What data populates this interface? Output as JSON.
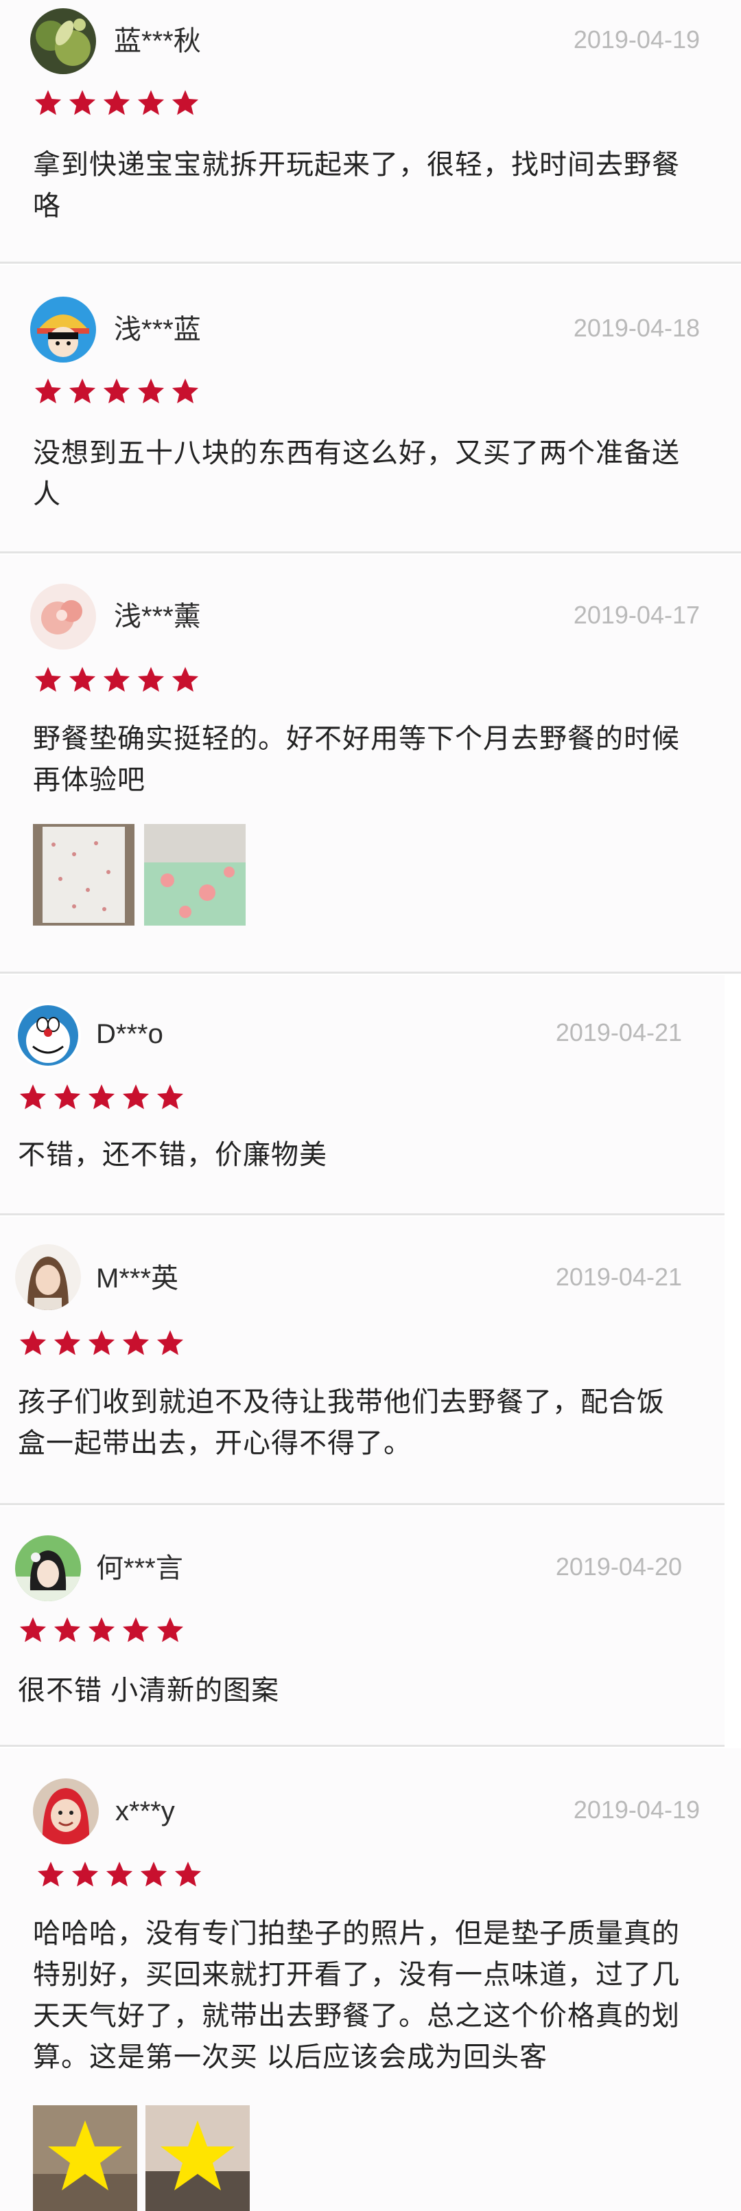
{
  "colors": {
    "star": "#c8102e",
    "date": "#b9b9b9",
    "divider": "#e3e3e3"
  },
  "reviews": [
    {
      "user": "蓝***秋",
      "date": "2019-04-19",
      "rating": 5,
      "avatar_icon": "green-plant-avatar",
      "text": [
        "拿到快递宝宝就拆开玩起来了，很轻，找时间去野餐",
        "咯"
      ]
    },
    {
      "user": "浅***蓝",
      "date": "2019-04-18",
      "rating": 5,
      "avatar_icon": "cartoon-girl-avatar",
      "text": [
        "没想到五十八块的东西有这么好，又买了两个准备送",
        "人"
      ]
    },
    {
      "user": "浅***薰",
      "date": "2019-04-17",
      "rating": 5,
      "avatar_icon": "pink-flower-avatar",
      "text": [
        "野餐垫确实挺轻的。好不好用等下个月去野餐的时候",
        "再体验吧"
      ],
      "photos": [
        "white-mat-photo",
        "green-floral-mat-photo"
      ]
    },
    {
      "user": "D***o",
      "date": "2019-04-21",
      "rating": 5,
      "avatar_icon": "doraemon-avatar",
      "text": [
        "不错，还不错，价廉物美"
      ]
    },
    {
      "user": "M***英",
      "date": "2019-04-21",
      "rating": 5,
      "avatar_icon": "woman-portrait-avatar",
      "text": [
        "孩子们收到就迫不及待让我带他们去野餐了，配合饭",
        "盒一起带出去，开心得不得了。"
      ]
    },
    {
      "user": "何***言",
      "date": "2019-04-20",
      "rating": 5,
      "avatar_icon": "woman-hair-flower-avatar",
      "text": [
        "很不错 小清新的图案"
      ]
    },
    {
      "user": "x***y",
      "date": "2019-04-19",
      "rating": 5,
      "avatar_icon": "child-red-hood-avatar",
      "text": [
        "哈哈哈，没有专门拍垫子的照片，但是垫子质量真的",
        "特别好，买回来就打开看了，没有一点味道，过了几",
        "天天气好了，就带出去野餐了。总之这个价格真的划",
        "算。这是第一次买 以后应该会成为回头客"
      ],
      "photos": [
        "child-photo-star-covered",
        "child-photo-star-covered-2"
      ]
    }
  ]
}
